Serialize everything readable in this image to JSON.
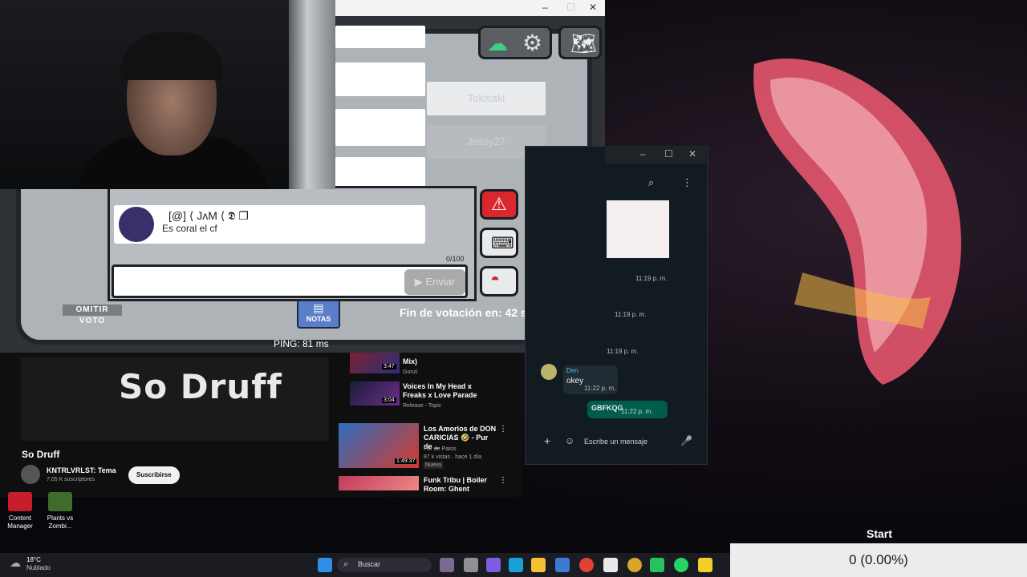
{
  "wallpaper": {
    "accent": "#e6566d"
  },
  "game": {
    "player_names": [
      "Tokisaki",
      "Jessy27"
    ],
    "chat_name": "[@] ⟨ JᴧM ⟨ 𝕯 ❐",
    "chat_message": "Es coral el cf",
    "char_count": "0/100",
    "send_label": "Enviar",
    "skip_vote_label": "OMITIR VOTO",
    "notes_label": "NOTAS",
    "timer": "Fin de votación en: 42 s",
    "ping": "PING: 81 ms"
  },
  "youtube": {
    "video_title_overlay": "So Druff",
    "title": "So Druff",
    "channel": "KNTRLVRLST: Tema",
    "subscribers": "7.05 K suscriptores",
    "subscribe_label": "Suscribirse",
    "items": [
      {
        "title": "Mix)",
        "duration": "3:47",
        "meta": "Gonzi"
      },
      {
        "title": "Voices In My Head x Freaks x Love Parade",
        "duration": "3:04",
        "meta": "Release - Topic"
      },
      {
        "title": "Los Amorios de DON CARICIAS 🤣 - Pur de ...",
        "duration": "1:49:37",
        "meta": "Pur de Patos",
        "meta2": "87 k vistas · hace 1 día",
        "badge": "Nuevo"
      },
      {
        "title": "Funk Tribu | Boiler Room: Ghent",
        "duration": "",
        "meta": ""
      }
    ]
  },
  "whatsapp": {
    "times": [
      "11:19 p. m.",
      "11:19 p. m.",
      "11:19 p. m."
    ],
    "sender": "Den",
    "incoming": "okey",
    "incoming_time": "11:22 p. m.",
    "outgoing": "GBFKQG",
    "outgoing_time": "11:22 p. m.",
    "compose_placeholder": "Escribe un mensaje"
  },
  "desktop": {
    "icons": [
      {
        "label": "Content Manager"
      },
      {
        "label": "Plants vs Zombi..."
      }
    ]
  },
  "taskbar": {
    "weather_temp": "18°C",
    "weather_desc": "Nublado",
    "search_label": "Buscar"
  },
  "widget": {
    "label": "Start",
    "value": "0 (0.00%)"
  }
}
